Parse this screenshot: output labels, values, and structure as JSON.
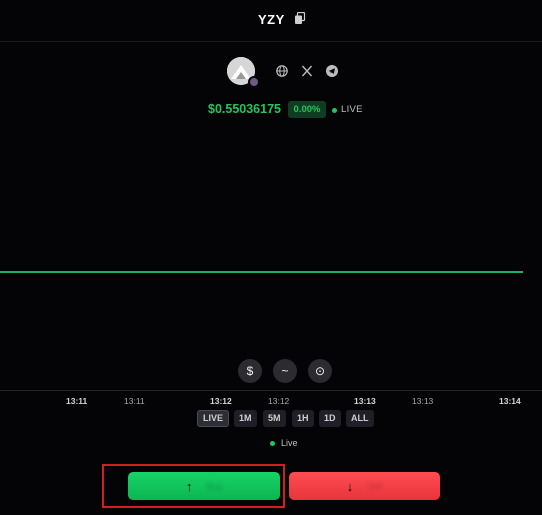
{
  "header": {
    "ticker": "YZY",
    "copy_icon": "copy-icon"
  },
  "token": {
    "avatar_icon": "token-avatar",
    "social_icons": [
      "globe-icon",
      "x-twitter-icon",
      "telegram-icon"
    ]
  },
  "price": {
    "value": "$0.55036175",
    "change": "0.00%",
    "live_label": "LIVE"
  },
  "chart": {
    "tools": [
      "$",
      "~",
      "⊙"
    ],
    "ticks": [
      "13:11",
      "13:11",
      "13:12",
      "13:12",
      "13:13",
      "13:13",
      "13:14"
    ]
  },
  "timeframes": {
    "items": [
      "LIVE",
      "1M",
      "5M",
      "1H",
      "1D",
      "ALL"
    ],
    "active": "LIVE"
  },
  "status": {
    "live_label": "Live"
  },
  "actions": {
    "up_arrow": "↑",
    "down_arrow": "↓",
    "up_label": "Buy",
    "down_label": "Sell"
  },
  "colors": {
    "up": "#16d466",
    "down": "#ff4d52",
    "price_text": "#22c55e",
    "highlight": "#d01f1f"
  }
}
